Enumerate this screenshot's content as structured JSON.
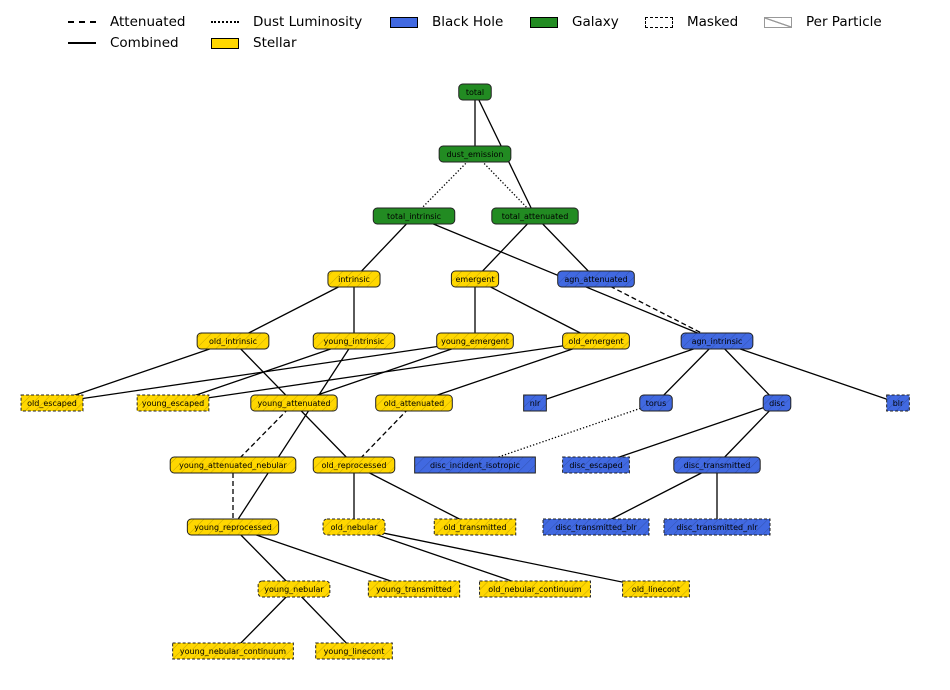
{
  "legend": {
    "items": [
      {
        "label": "Attenuated",
        "kind": "line",
        "style": "dashed"
      },
      {
        "label": "Combined",
        "kind": "line",
        "style": "solid"
      },
      {
        "label": "Dust Luminosity",
        "kind": "line",
        "style": "dotted"
      },
      {
        "label": "Stellar",
        "kind": "patch",
        "color": "#FFD700"
      },
      {
        "label": "Black Hole",
        "kind": "patch",
        "color": "#4169E1"
      },
      {
        "label": "Galaxy",
        "kind": "patch",
        "color": "#228B22"
      },
      {
        "label": "Masked",
        "kind": "patch-masked"
      },
      {
        "label": "Per Particle",
        "kind": "patch-hatched"
      }
    ]
  },
  "colors": {
    "stellar": "#FFD700",
    "blackhole": "#4169E1",
    "galaxy": "#228B22",
    "edge": "#000000",
    "node_border": "#222222"
  },
  "nodes": [
    {
      "id": "total",
      "type": "galaxy",
      "masked": false,
      "per_particle": false,
      "rounded": true
    },
    {
      "id": "dust_emission",
      "type": "galaxy",
      "masked": false,
      "per_particle": false,
      "rounded": true
    },
    {
      "id": "total_intrinsic",
      "type": "galaxy",
      "masked": false,
      "per_particle": false,
      "rounded": true
    },
    {
      "id": "total_attenuated",
      "type": "galaxy",
      "masked": false,
      "per_particle": false,
      "rounded": true
    },
    {
      "id": "intrinsic",
      "type": "stellar",
      "masked": false,
      "per_particle": true,
      "rounded": true
    },
    {
      "id": "emergent",
      "type": "stellar",
      "masked": false,
      "per_particle": true,
      "rounded": true
    },
    {
      "id": "agn_attenuated",
      "type": "blackhole",
      "masked": false,
      "per_particle": true,
      "rounded": true
    },
    {
      "id": "old_intrinsic",
      "type": "stellar",
      "masked": false,
      "per_particle": true,
      "rounded": true
    },
    {
      "id": "young_intrinsic",
      "type": "stellar",
      "masked": false,
      "per_particle": true,
      "rounded": true
    },
    {
      "id": "young_emergent",
      "type": "stellar",
      "masked": false,
      "per_particle": true,
      "rounded": true
    },
    {
      "id": "old_emergent",
      "type": "stellar",
      "masked": false,
      "per_particle": true,
      "rounded": true
    },
    {
      "id": "agn_intrinsic",
      "type": "blackhole",
      "masked": false,
      "per_particle": true,
      "rounded": true
    },
    {
      "id": "old_escaped",
      "type": "stellar",
      "masked": true,
      "per_particle": true,
      "rounded": false
    },
    {
      "id": "young_escaped",
      "type": "stellar",
      "masked": true,
      "per_particle": true,
      "rounded": false
    },
    {
      "id": "young_attenuated",
      "type": "stellar",
      "masked": false,
      "per_particle": true,
      "rounded": true
    },
    {
      "id": "old_attenuated",
      "type": "stellar",
      "masked": false,
      "per_particle": true,
      "rounded": true
    },
    {
      "id": "nlr",
      "type": "blackhole",
      "masked": false,
      "per_particle": true,
      "rounded": false
    },
    {
      "id": "torus",
      "type": "blackhole",
      "masked": false,
      "per_particle": true,
      "rounded": true
    },
    {
      "id": "disc",
      "type": "blackhole",
      "masked": false,
      "per_particle": true,
      "rounded": true
    },
    {
      "id": "blr",
      "type": "blackhole",
      "masked": true,
      "per_particle": true,
      "rounded": false
    },
    {
      "id": "young_attenuated_nebular",
      "type": "stellar",
      "masked": false,
      "per_particle": true,
      "rounded": true
    },
    {
      "id": "old_reprocessed",
      "type": "stellar",
      "masked": false,
      "per_particle": true,
      "rounded": true
    },
    {
      "id": "disc_incident_isotropic",
      "type": "blackhole",
      "masked": false,
      "per_particle": true,
      "rounded": false
    },
    {
      "id": "disc_escaped",
      "type": "blackhole",
      "masked": true,
      "per_particle": true,
      "rounded": false
    },
    {
      "id": "disc_transmitted",
      "type": "blackhole",
      "masked": false,
      "per_particle": true,
      "rounded": true
    },
    {
      "id": "young_reprocessed",
      "type": "stellar",
      "masked": false,
      "per_particle": true,
      "rounded": true
    },
    {
      "id": "old_nebular",
      "type": "stellar",
      "masked": true,
      "per_particle": true,
      "rounded": true
    },
    {
      "id": "old_transmitted",
      "type": "stellar",
      "masked": true,
      "per_particle": true,
      "rounded": false
    },
    {
      "id": "disc_transmitted_blr",
      "type": "blackhole",
      "masked": true,
      "per_particle": true,
      "rounded": false
    },
    {
      "id": "disc_transmitted_nlr",
      "type": "blackhole",
      "masked": true,
      "per_particle": true,
      "rounded": false
    },
    {
      "id": "young_nebular",
      "type": "stellar",
      "masked": true,
      "per_particle": true,
      "rounded": true
    },
    {
      "id": "young_transmitted",
      "type": "stellar",
      "masked": true,
      "per_particle": true,
      "rounded": false
    },
    {
      "id": "old_nebular_continuum",
      "type": "stellar",
      "masked": true,
      "per_particle": true,
      "rounded": false
    },
    {
      "id": "old_linecont",
      "type": "stellar",
      "masked": true,
      "per_particle": true,
      "rounded": false
    },
    {
      "id": "young_nebular_continuum",
      "type": "stellar",
      "masked": true,
      "per_particle": true,
      "rounded": false
    },
    {
      "id": "young_linecont",
      "type": "stellar",
      "masked": true,
      "per_particle": true,
      "rounded": false
    }
  ],
  "edges": [
    {
      "from": "total",
      "to": "dust_emission",
      "style": "solid"
    },
    {
      "from": "total",
      "to": "total_attenuated",
      "style": "solid"
    },
    {
      "from": "dust_emission",
      "to": "total_intrinsic",
      "style": "dotted"
    },
    {
      "from": "dust_emission",
      "to": "total_attenuated",
      "style": "dotted"
    },
    {
      "from": "total_intrinsic",
      "to": "intrinsic",
      "style": "solid"
    },
    {
      "from": "total_intrinsic",
      "to": "agn_intrinsic",
      "style": "solid"
    },
    {
      "from": "total_attenuated",
      "to": "emergent",
      "style": "solid"
    },
    {
      "from": "total_attenuated",
      "to": "agn_attenuated",
      "style": "solid"
    },
    {
      "from": "agn_attenuated",
      "to": "agn_intrinsic",
      "style": "dashed"
    },
    {
      "from": "intrinsic",
      "to": "old_intrinsic",
      "style": "solid"
    },
    {
      "from": "intrinsic",
      "to": "young_intrinsic",
      "style": "solid"
    },
    {
      "from": "emergent",
      "to": "young_emergent",
      "style": "solid"
    },
    {
      "from": "emergent",
      "to": "old_emergent",
      "style": "solid"
    },
    {
      "from": "old_intrinsic",
      "to": "old_escaped",
      "style": "solid"
    },
    {
      "from": "old_intrinsic",
      "to": "old_reprocessed",
      "style": "solid"
    },
    {
      "from": "young_intrinsic",
      "to": "young_escaped",
      "style": "solid"
    },
    {
      "from": "young_intrinsic",
      "to": "young_reprocessed",
      "style": "solid"
    },
    {
      "from": "young_emergent",
      "to": "old_escaped",
      "style": "solid"
    },
    {
      "from": "young_emergent",
      "to": "young_attenuated",
      "style": "solid"
    },
    {
      "from": "old_emergent",
      "to": "young_escaped",
      "style": "solid"
    },
    {
      "from": "old_emergent",
      "to": "old_attenuated",
      "style": "solid"
    },
    {
      "from": "young_attenuated",
      "to": "young_attenuated_nebular",
      "style": "dashed"
    },
    {
      "from": "old_attenuated",
      "to": "old_reprocessed",
      "style": "dashed"
    },
    {
      "from": "young_attenuated_nebular",
      "to": "young_reprocessed",
      "style": "dashed"
    },
    {
      "from": "agn_intrinsic",
      "to": "nlr",
      "style": "solid"
    },
    {
      "from": "agn_intrinsic",
      "to": "torus",
      "style": "solid"
    },
    {
      "from": "agn_intrinsic",
      "to": "disc",
      "style": "solid"
    },
    {
      "from": "agn_intrinsic",
      "to": "blr",
      "style": "solid"
    },
    {
      "from": "torus",
      "to": "disc_incident_isotropic",
      "style": "dotted"
    },
    {
      "from": "disc",
      "to": "disc_escaped",
      "style": "solid"
    },
    {
      "from": "disc",
      "to": "disc_transmitted",
      "style": "solid"
    },
    {
      "from": "disc_transmitted",
      "to": "disc_transmitted_blr",
      "style": "solid"
    },
    {
      "from": "disc_transmitted",
      "to": "disc_transmitted_nlr",
      "style": "solid"
    },
    {
      "from": "old_reprocessed",
      "to": "old_nebular",
      "style": "solid"
    },
    {
      "from": "old_reprocessed",
      "to": "old_transmitted",
      "style": "solid"
    },
    {
      "from": "young_reprocessed",
      "to": "young_nebular",
      "style": "solid"
    },
    {
      "from": "young_reprocessed",
      "to": "young_transmitted",
      "style": "solid"
    },
    {
      "from": "old_nebular",
      "to": "old_nebular_continuum",
      "style": "solid"
    },
    {
      "from": "old_nebular",
      "to": "old_linecont",
      "style": "solid"
    },
    {
      "from": "young_nebular",
      "to": "young_nebular_continuum",
      "style": "solid"
    },
    {
      "from": "young_nebular",
      "to": "young_linecont",
      "style": "solid"
    }
  ]
}
